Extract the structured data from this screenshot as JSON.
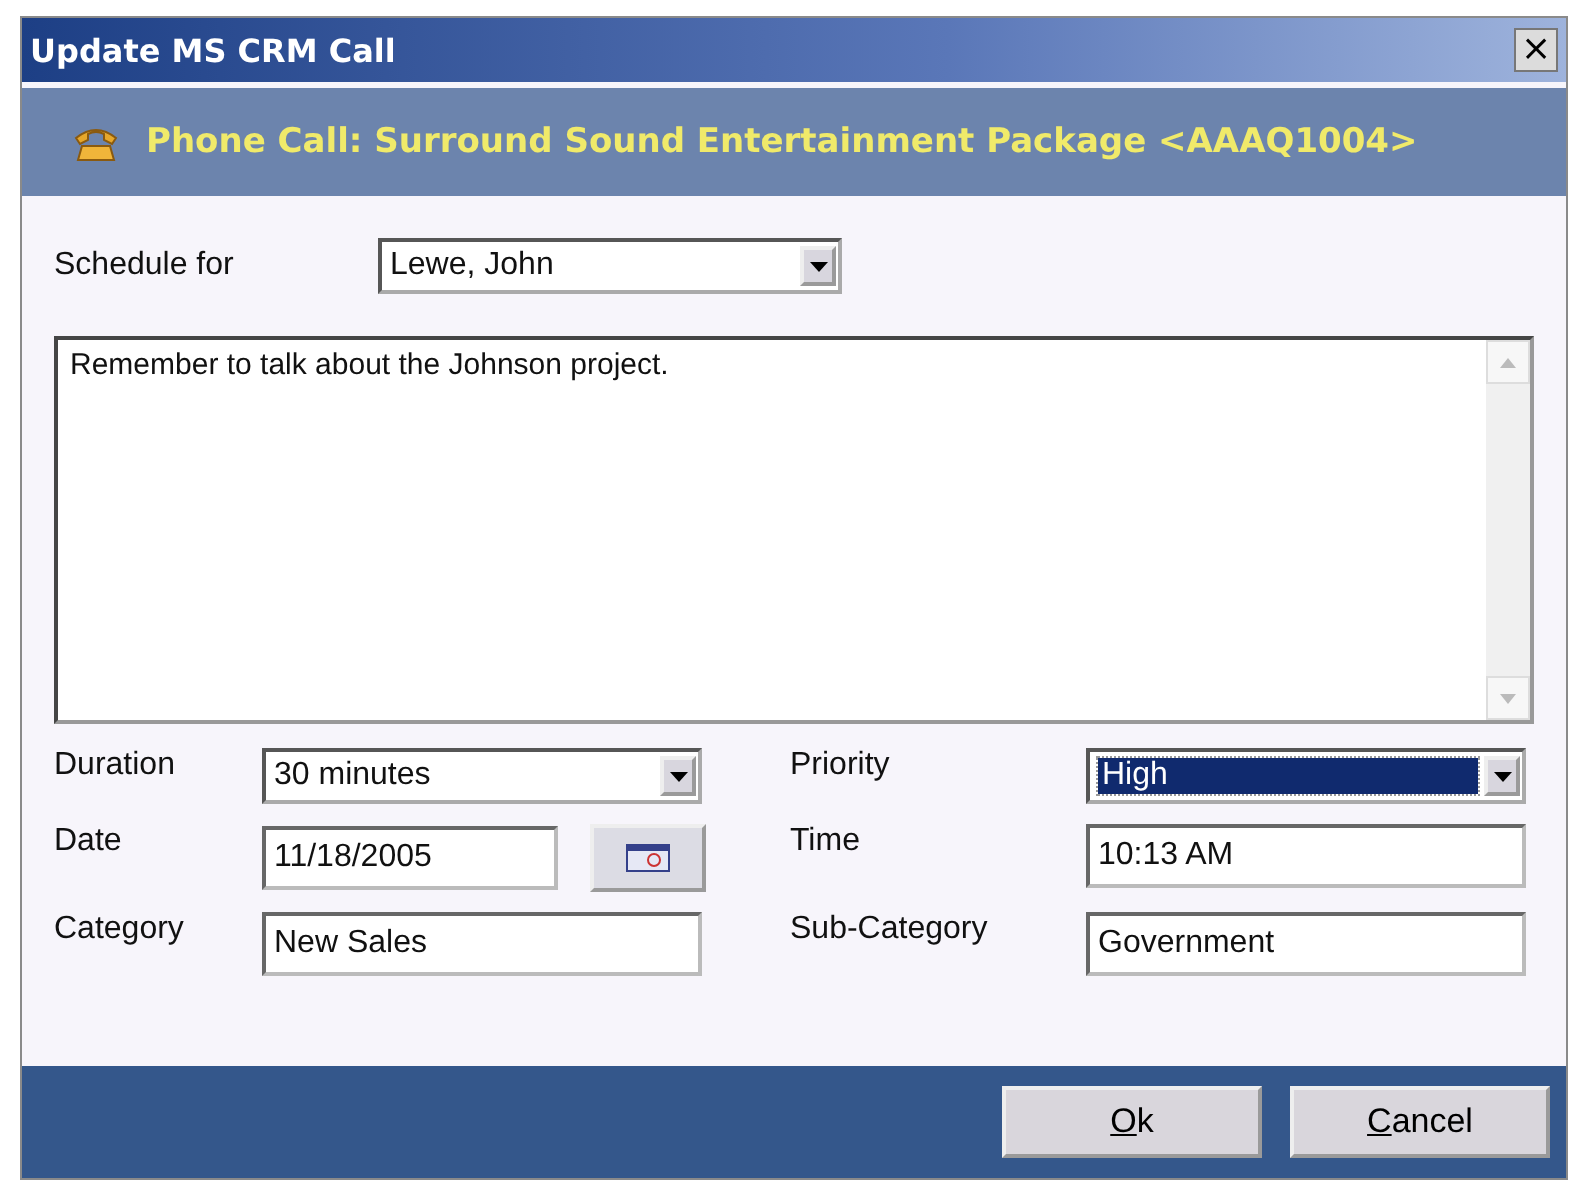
{
  "window": {
    "title": "Update MS CRM Call",
    "close": "×"
  },
  "header": {
    "title": "Phone Call: Surround Sound Entertainment Package <AAAQ1004>"
  },
  "schedule": {
    "label": "Schedule for",
    "value": "Lewe, John"
  },
  "notes": {
    "value": "Remember to talk about the Johnson project."
  },
  "fields": [
    {
      "label": "Duration",
      "value": "30 minutes",
      "kind": "dropdown",
      "selected": false
    },
    {
      "label": "Priority",
      "value": "High",
      "kind": "dropdown",
      "selected": true
    },
    {
      "label": "Date",
      "value": "11/18/2005",
      "kind": "date",
      "selected": false
    },
    {
      "label": "Time",
      "value": "10:13 AM",
      "kind": "text",
      "selected": false
    },
    {
      "label": "Category",
      "value": "New Sales",
      "kind": "text",
      "selected": false
    },
    {
      "label": "Sub-Category",
      "value": "Government",
      "kind": "text",
      "selected": false
    }
  ],
  "buttons": [
    "Ok",
    "Cancel"
  ]
}
